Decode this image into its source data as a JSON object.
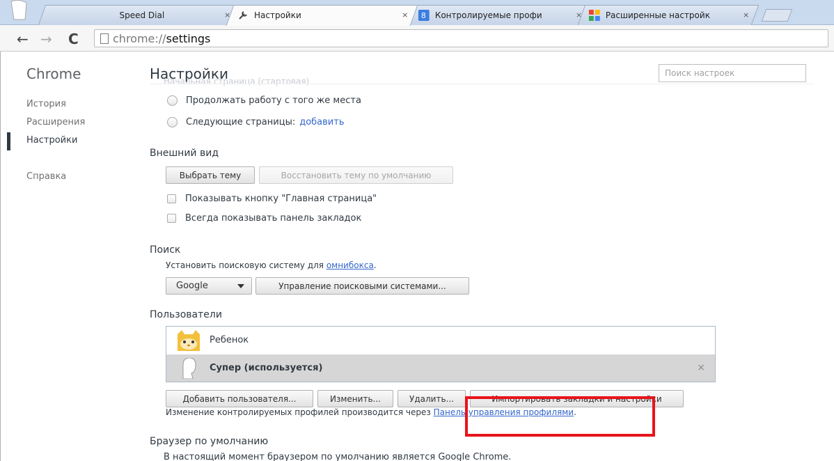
{
  "tabs": [
    {
      "label": "Speed Dial",
      "icon": "ghost-avatar-icon",
      "active": false
    },
    {
      "label": "Настройки",
      "icon": "wrench-icon",
      "active": true
    },
    {
      "label": "Контролируемые профи",
      "icon": "google-plus-icon",
      "active": false
    },
    {
      "label": "Расширенные настройк",
      "icon": "google-apps-icon",
      "active": false
    }
  ],
  "tab_close_glyph": "×",
  "toolbar": {
    "back": "←",
    "forward": "→",
    "reload": "C",
    "url_scheme": "chrome://",
    "url_host": "settings"
  },
  "sidebar": {
    "title": "Chrome",
    "items": [
      "История",
      "Расширения",
      "Настройки",
      "Справка"
    ],
    "active_index": 2
  },
  "header": {
    "title": "Настройки",
    "ghost_text": "Начальная страница (стартовая)",
    "search_placeholder": "Поиск настроек"
  },
  "startup": {
    "radio_1": "Продолжать работу с того же места",
    "radio_2": "Следующие страницы:",
    "radio_2_link": "добавить"
  },
  "appearance": {
    "title": "Внешний вид",
    "theme_button": "Выбрать тему",
    "reset_theme_button": "Восстановить тему по умолчанию",
    "checkbox_home": "Показывать кнопку \"Главная страница\"",
    "checkbox_bookmarks": "Всегда показывать панель закладок"
  },
  "search_section": {
    "title": "Поиск",
    "text": "Установить поисковую систему для",
    "link": "омнибокса",
    "suffix": ".",
    "engine": "Google",
    "manage_button": "Управление поисковыми системами..."
  },
  "users": {
    "title": "Пользователи",
    "list": [
      {
        "name": "Ребенок",
        "icon": "cat-avatar-icon",
        "selected": false
      },
      {
        "name": "Супер (используется)",
        "icon": "ghost-avatar-icon",
        "selected": true
      }
    ],
    "remove_glyph": "×",
    "add_button": "Добавить пользователя...",
    "edit_button": "Изменить...",
    "delete_button": "Удалить...",
    "import_button": "Импортировать закладки и настройки",
    "info_text": "Изменение контролируемых профилей производится через",
    "info_link": "Панель управления профилями",
    "info_suffix": "."
  },
  "default_browser": {
    "title": "Браузер по умолчанию",
    "text": "В настоящий момент браузером по умолчанию является Google Chrome."
  },
  "colors": {
    "link": "#3366cc",
    "highlight_box": "#e8141b",
    "selected_row": "#d6d6d6"
  }
}
